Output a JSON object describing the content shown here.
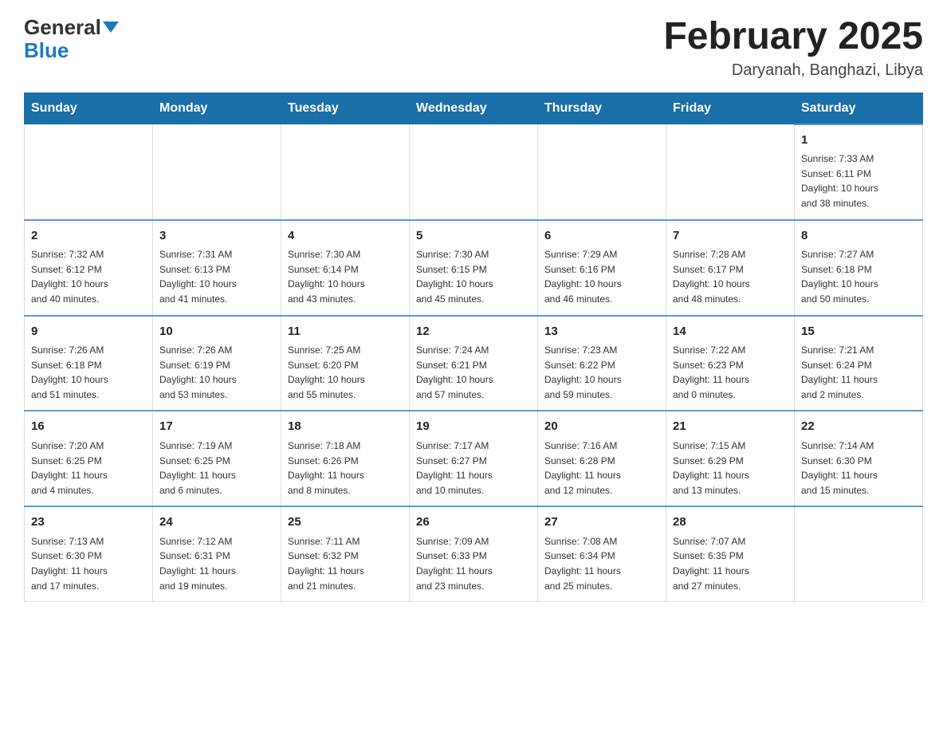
{
  "header": {
    "logo_general": "General",
    "logo_blue": "Blue",
    "title": "February 2025",
    "subtitle": "Daryanah, Banghazi, Libya"
  },
  "weekdays": [
    "Sunday",
    "Monday",
    "Tuesday",
    "Wednesday",
    "Thursday",
    "Friday",
    "Saturday"
  ],
  "weeks": [
    [
      {
        "day": "",
        "info": ""
      },
      {
        "day": "",
        "info": ""
      },
      {
        "day": "",
        "info": ""
      },
      {
        "day": "",
        "info": ""
      },
      {
        "day": "",
        "info": ""
      },
      {
        "day": "",
        "info": ""
      },
      {
        "day": "1",
        "info": "Sunrise: 7:33 AM\nSunset: 6:11 PM\nDaylight: 10 hours\nand 38 minutes."
      }
    ],
    [
      {
        "day": "2",
        "info": "Sunrise: 7:32 AM\nSunset: 6:12 PM\nDaylight: 10 hours\nand 40 minutes."
      },
      {
        "day": "3",
        "info": "Sunrise: 7:31 AM\nSunset: 6:13 PM\nDaylight: 10 hours\nand 41 minutes."
      },
      {
        "day": "4",
        "info": "Sunrise: 7:30 AM\nSunset: 6:14 PM\nDaylight: 10 hours\nand 43 minutes."
      },
      {
        "day": "5",
        "info": "Sunrise: 7:30 AM\nSunset: 6:15 PM\nDaylight: 10 hours\nand 45 minutes."
      },
      {
        "day": "6",
        "info": "Sunrise: 7:29 AM\nSunset: 6:16 PM\nDaylight: 10 hours\nand 46 minutes."
      },
      {
        "day": "7",
        "info": "Sunrise: 7:28 AM\nSunset: 6:17 PM\nDaylight: 10 hours\nand 48 minutes."
      },
      {
        "day": "8",
        "info": "Sunrise: 7:27 AM\nSunset: 6:18 PM\nDaylight: 10 hours\nand 50 minutes."
      }
    ],
    [
      {
        "day": "9",
        "info": "Sunrise: 7:26 AM\nSunset: 6:18 PM\nDaylight: 10 hours\nand 51 minutes."
      },
      {
        "day": "10",
        "info": "Sunrise: 7:26 AM\nSunset: 6:19 PM\nDaylight: 10 hours\nand 53 minutes."
      },
      {
        "day": "11",
        "info": "Sunrise: 7:25 AM\nSunset: 6:20 PM\nDaylight: 10 hours\nand 55 minutes."
      },
      {
        "day": "12",
        "info": "Sunrise: 7:24 AM\nSunset: 6:21 PM\nDaylight: 10 hours\nand 57 minutes."
      },
      {
        "day": "13",
        "info": "Sunrise: 7:23 AM\nSunset: 6:22 PM\nDaylight: 10 hours\nand 59 minutes."
      },
      {
        "day": "14",
        "info": "Sunrise: 7:22 AM\nSunset: 6:23 PM\nDaylight: 11 hours\nand 0 minutes."
      },
      {
        "day": "15",
        "info": "Sunrise: 7:21 AM\nSunset: 6:24 PM\nDaylight: 11 hours\nand 2 minutes."
      }
    ],
    [
      {
        "day": "16",
        "info": "Sunrise: 7:20 AM\nSunset: 6:25 PM\nDaylight: 11 hours\nand 4 minutes."
      },
      {
        "day": "17",
        "info": "Sunrise: 7:19 AM\nSunset: 6:25 PM\nDaylight: 11 hours\nand 6 minutes."
      },
      {
        "day": "18",
        "info": "Sunrise: 7:18 AM\nSunset: 6:26 PM\nDaylight: 11 hours\nand 8 minutes."
      },
      {
        "day": "19",
        "info": "Sunrise: 7:17 AM\nSunset: 6:27 PM\nDaylight: 11 hours\nand 10 minutes."
      },
      {
        "day": "20",
        "info": "Sunrise: 7:16 AM\nSunset: 6:28 PM\nDaylight: 11 hours\nand 12 minutes."
      },
      {
        "day": "21",
        "info": "Sunrise: 7:15 AM\nSunset: 6:29 PM\nDaylight: 11 hours\nand 13 minutes."
      },
      {
        "day": "22",
        "info": "Sunrise: 7:14 AM\nSunset: 6:30 PM\nDaylight: 11 hours\nand 15 minutes."
      }
    ],
    [
      {
        "day": "23",
        "info": "Sunrise: 7:13 AM\nSunset: 6:30 PM\nDaylight: 11 hours\nand 17 minutes."
      },
      {
        "day": "24",
        "info": "Sunrise: 7:12 AM\nSunset: 6:31 PM\nDaylight: 11 hours\nand 19 minutes."
      },
      {
        "day": "25",
        "info": "Sunrise: 7:11 AM\nSunset: 6:32 PM\nDaylight: 11 hours\nand 21 minutes."
      },
      {
        "day": "26",
        "info": "Sunrise: 7:09 AM\nSunset: 6:33 PM\nDaylight: 11 hours\nand 23 minutes."
      },
      {
        "day": "27",
        "info": "Sunrise: 7:08 AM\nSunset: 6:34 PM\nDaylight: 11 hours\nand 25 minutes."
      },
      {
        "day": "28",
        "info": "Sunrise: 7:07 AM\nSunset: 6:35 PM\nDaylight: 11 hours\nand 27 minutes."
      },
      {
        "day": "",
        "info": ""
      }
    ]
  ]
}
